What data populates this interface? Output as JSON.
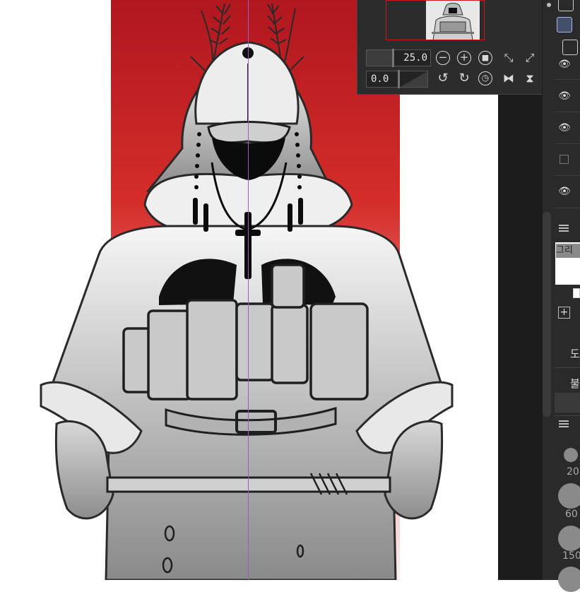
{
  "navigator": {
    "zoom_value": "25.0",
    "rotation_value": "0.0",
    "buttons": {
      "zoom_out": "−",
      "zoom_in": "+",
      "fit": "■",
      "fit_window": "⤡",
      "actual_size": "⤢",
      "rotate_left": "↺",
      "rotate_right": "↻",
      "reset_rotation": "◷",
      "flip_horizontal": "⧓",
      "flip_vertical": "⧗"
    }
  },
  "layer_panel": {
    "eye_glyph": "👁",
    "menu_glyph": "≡",
    "add_glyph": "+"
  },
  "sub_tool_panel": {
    "swatch_label": "그리",
    "item_1": "도",
    "item_2": "불"
  },
  "brush_size_panel": {
    "sizes": [
      "20",
      "60",
      "150"
    ]
  },
  "colors": {
    "gradient_top": "#b51a22",
    "gradient_mid": "#d73a36",
    "gradient_bottom": "#fbe9ea",
    "panel_bg": "#2c2c2c",
    "accent_red": "#d01818",
    "guide_purple": "#9a5cc8"
  }
}
